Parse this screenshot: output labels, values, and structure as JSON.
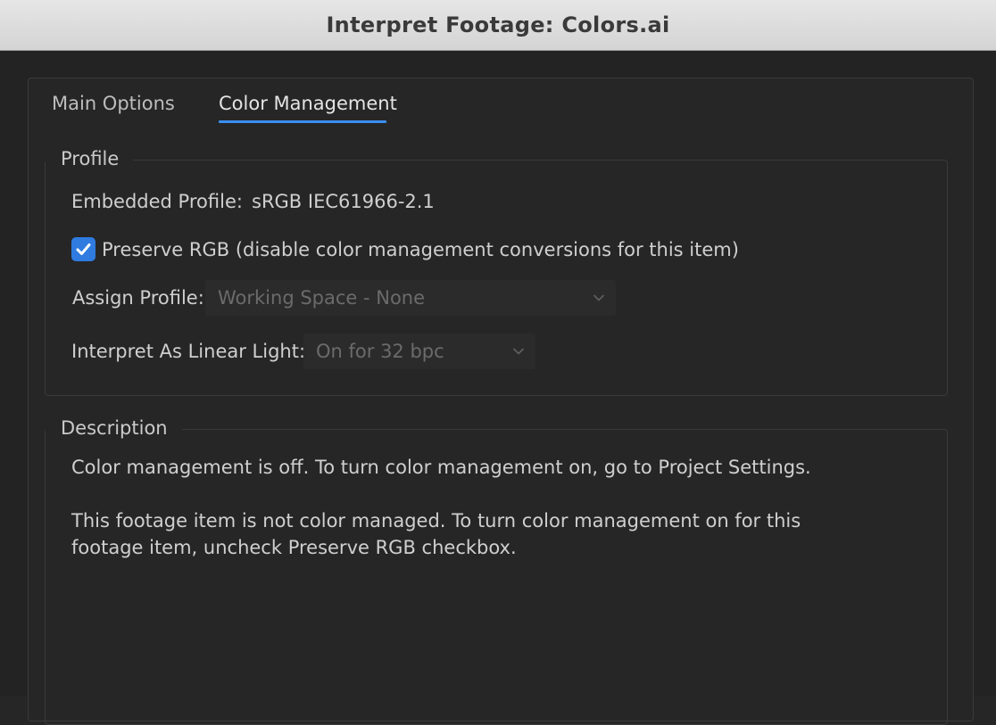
{
  "window": {
    "title": "Interpret Footage: Colors.ai"
  },
  "tabs": [
    {
      "label": "Main Options",
      "active": false
    },
    {
      "label": "Color Management",
      "active": true
    }
  ],
  "profile": {
    "legend": "Profile",
    "embedded_label": "Embedded Profile:",
    "embedded_value": "sRGB IEC61966-2.1",
    "preserve_rgb": {
      "label": "Preserve RGB (disable color management conversions for this item)",
      "checked": true
    },
    "assign_profile": {
      "label": "Assign Profile:",
      "value": "Working Space - None",
      "enabled": false
    },
    "linear_light": {
      "label": "Interpret As Linear Light:",
      "value": "On for 32 bpc",
      "enabled": false
    }
  },
  "description": {
    "legend": "Description",
    "line1": "Color management is off. To turn color management on, go to Project Settings.",
    "line2": "This footage item is not color managed. To turn color management on for this",
    "line3": "footage item, uncheck Preserve RGB checkbox."
  },
  "colors": {
    "accent": "#2f7be0",
    "tab_underline": "#3b8ef0",
    "background": "#262626"
  },
  "icons": {
    "checkbox": "checkmark-icon",
    "dropdown": "chevron-down-icon"
  }
}
